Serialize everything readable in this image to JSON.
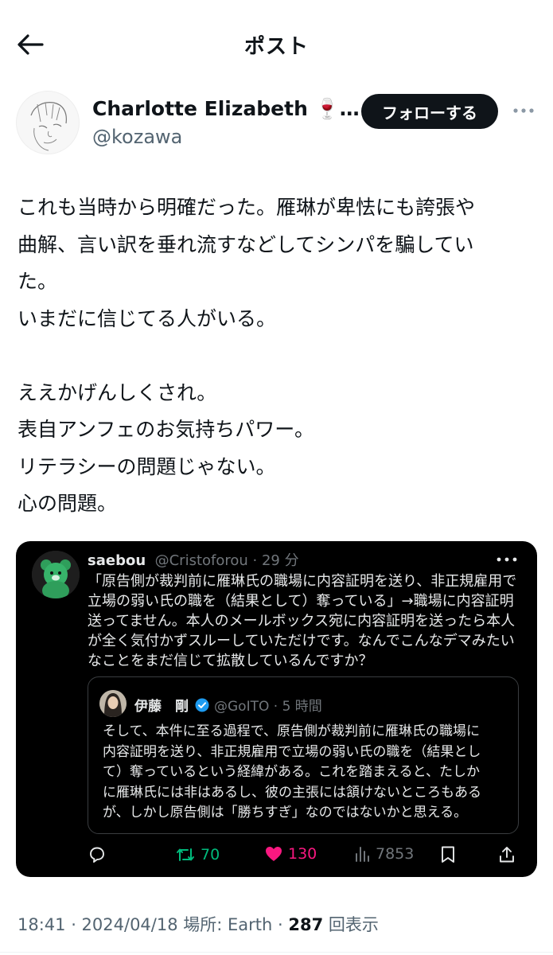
{
  "header": {
    "title": "ポスト"
  },
  "author": {
    "name": "Charlotte Elizabeth 🍷…",
    "handle": "@kozawa",
    "follow_label": "フォローする"
  },
  "tweet": {
    "text": "これも当時から明確だった。雁琳が卑怯にも誇張や\n曲解、言い訳を垂れ流すなどしてシンパを騙してい\nた。\nいまだに信じてる人がいる。\n\nええかげんしくされ。\n表自アンフェのお気持ちパワー。\nリテラシーの問題じゃない。\n心の問題。"
  },
  "quote": {
    "name": "saebou",
    "meta": "@Cristoforou · 29 分",
    "text": "「原告側が裁判前に雁琳氏の職場に内容証明を送り、非正規雇用で\n立場の弱い氏の職を（結果として）奪っている」→職場に内容証明\n送ってません。本人のメールボックス宛に内容証明を送ったら本人\nが全く気付かずスルーしていただけです。なんでこんなデマみたい\nなことをまだ信じて拡散しているんですか？",
    "inner": {
      "name": "伊藤　剛",
      "meta": "@GoITO · 5 時間",
      "text": "そして、本件に至る過程で、原告側が裁判前に雁琳氏の職場に\n内容証明を送り、非正規雇用で立場の弱い氏の職を（結果とし\nて）奪っているという経緯がある。これを踏まえると、たしか\nに雁琳氏には非はあるし、彼の主張には頷けないところもある\nが、しかし原告側は「勝ちすぎ」なのではないかと思える。"
    },
    "actions": {
      "retweets": "70",
      "likes": "130",
      "views": "7853"
    }
  },
  "footer": {
    "meta": "18:41 · 2024/04/18 場所: Earth · ",
    "view_count": "287",
    "view_suffix": " 回表示"
  },
  "colors": {
    "accent_green": "#00ba7c",
    "accent_pink": "#f91880",
    "verified_blue": "#1d9bf0"
  }
}
